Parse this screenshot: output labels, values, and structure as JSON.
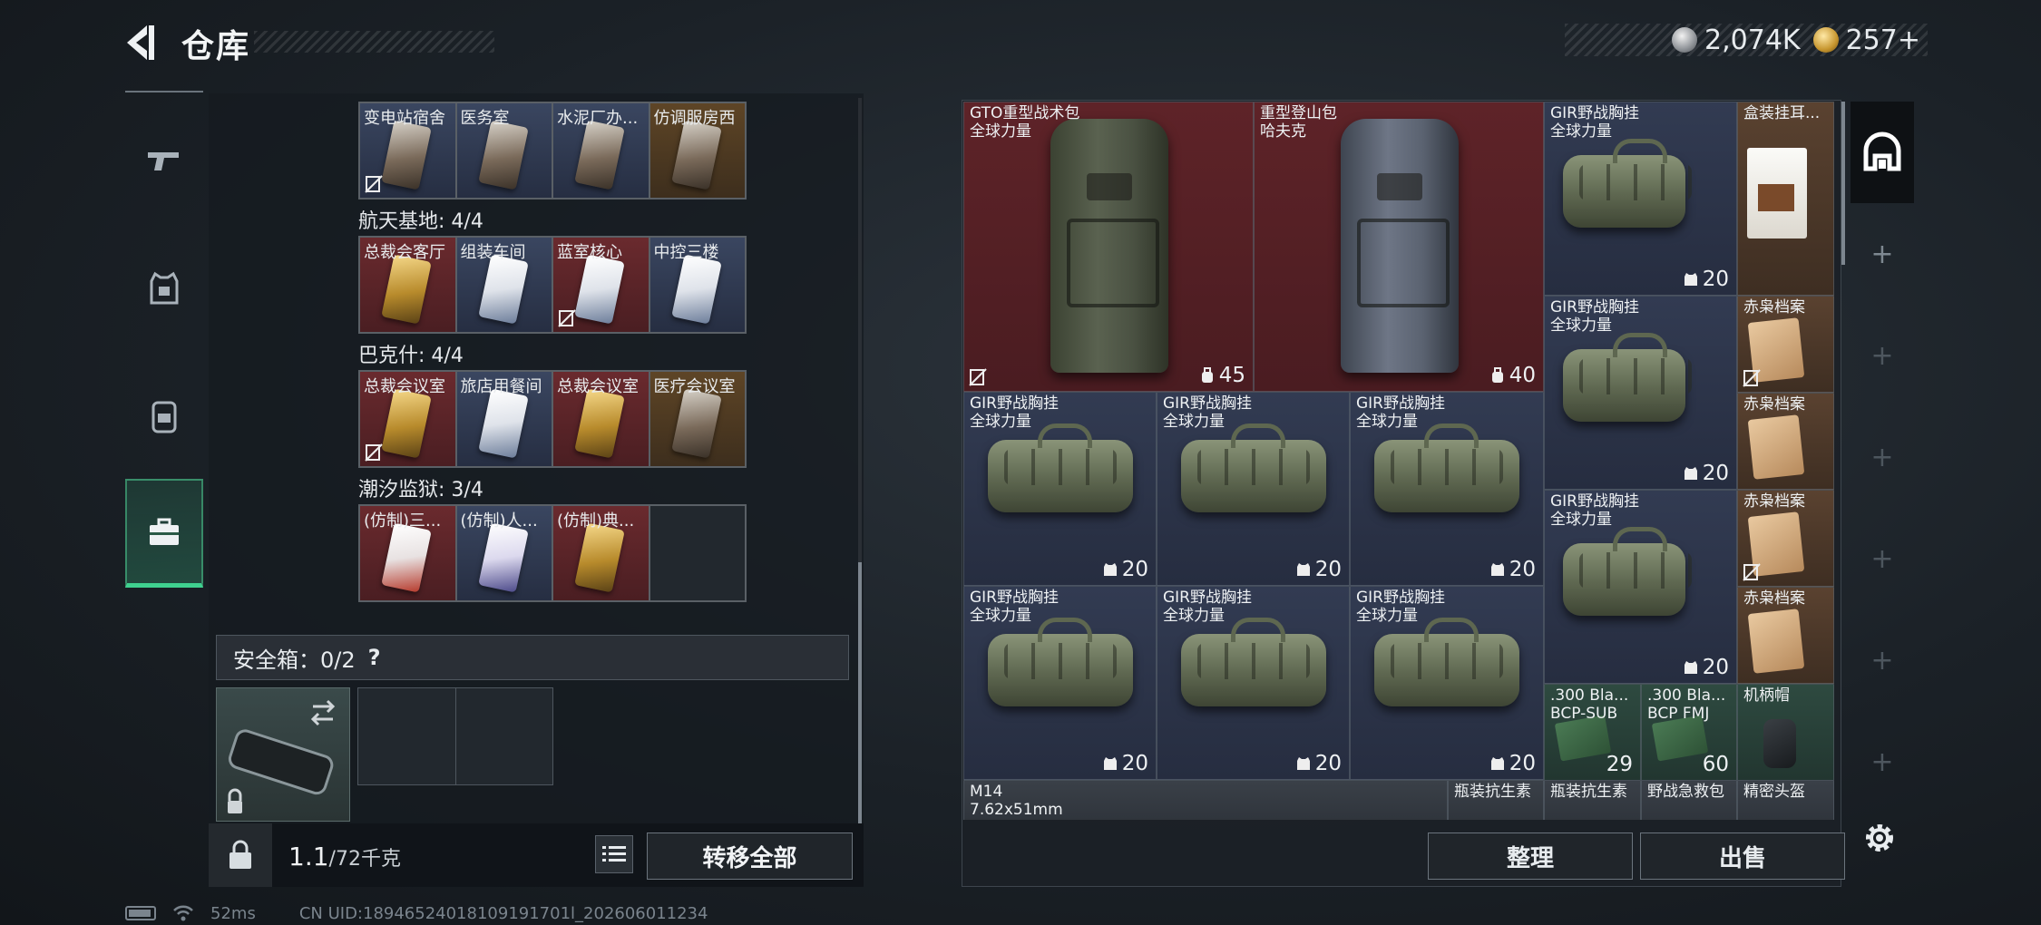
{
  "header": {
    "title": "仓库",
    "currency_silver": "2,074K",
    "currency_gold": "257+"
  },
  "left_nav": {
    "items": [
      "weapon-icon",
      "armor-icon",
      "backpack-icon",
      "toolbox-icon"
    ],
    "active_index": 3
  },
  "keycards": {
    "row0": [
      "变电站宿舍",
      "医务室",
      "水泥厂办...",
      "仿调服房西"
    ],
    "section1": "航天基地: 4/4",
    "row1": [
      "总裁会客厅",
      "组装车间",
      "蓝室核心",
      "中控三楼"
    ],
    "section2": "巴克什: 4/4",
    "row2": [
      "总裁会议室",
      "旅店用餐间",
      "总裁会议室",
      "医疗会议室"
    ],
    "section3": "潮汐监狱: 3/4",
    "row3": [
      "(仿制)三...",
      "(仿制)人...",
      "(仿制)典..."
    ]
  },
  "safebox": {
    "label": "安全箱：0/2",
    "help": "?"
  },
  "left_footer": {
    "weight": "1.1",
    "weight_unit": "/72千克",
    "transfer_all": "转移全部"
  },
  "stash": {
    "bp1_name": "GTO重型战术包\n全球力量",
    "bp1_count": "45",
    "bp2_name": "重型登山包\n哈夫克",
    "bp2_count": "40",
    "rig_name": "GIR野战胸挂\n全球力量",
    "rig_count": "20",
    "coffee_name": "盒装挂耳...",
    "file_name": "赤枭档案",
    "ammo1_name": ".300 Bla...\nBCP-SUB",
    "ammo1_count": "29",
    "ammo2_name": ".300 Bla...\nBCP FMJ",
    "ammo2_count": "60",
    "helmet_name": "机柄帽",
    "m14_name": "M14\n7.62x51mm",
    "antibiotic_name": "瓶装抗生素",
    "firstaid_name": "野战急救包",
    "precision_helmet_name": "精密头盔"
  },
  "right_footer": {
    "organize": "整理",
    "sell": "出售"
  },
  "status": {
    "ping": "52ms",
    "uid": "CN UID:18946524018109191701l_202606011234"
  },
  "colors": {
    "accent_green": "#3fd18f",
    "cell_red": "#5e2328",
    "cell_blue": "#323b52",
    "cell_gold": "#5a4230"
  }
}
